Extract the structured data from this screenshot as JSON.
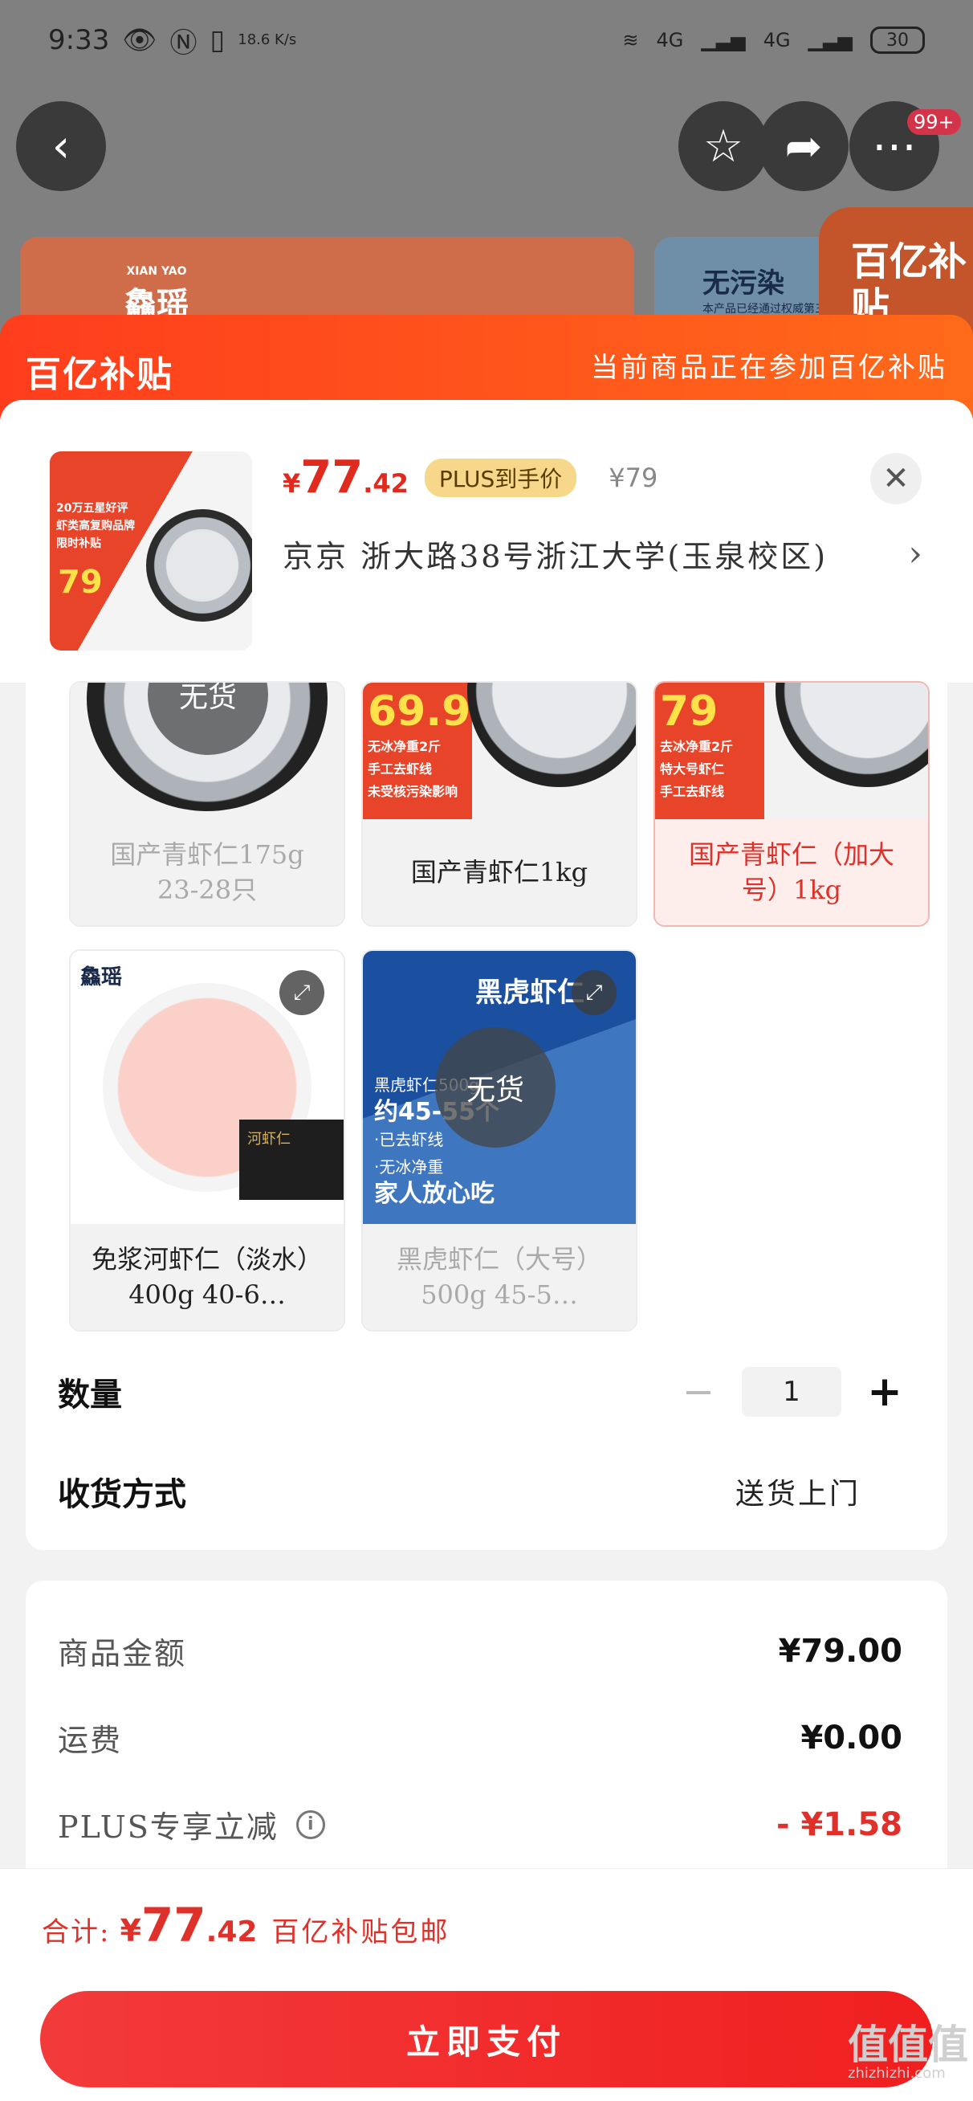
{
  "status_bar": {
    "time": "9:33",
    "speed": "18.6\nK/s",
    "network_1": "4G",
    "network_2": "4G",
    "battery": "30"
  },
  "nav": {
    "badge": "99+"
  },
  "background_page": {
    "brand_en": "XIAN YAO",
    "brand_cn": "鱻瑶",
    "right_card_text": "无污染",
    "right_card_sub": "本产品已经通过权威第三",
    "subsidy_badge": "百亿补贴"
  },
  "banner": {
    "logo": "百亿补贴",
    "note": "当前商品正在参加百亿补贴"
  },
  "product": {
    "thumb_lines": [
      "20万五星好评",
      "虾类高复购品牌",
      "限时补贴"
    ],
    "thumb_price": "79",
    "yen": "¥",
    "price_int": "77",
    "price_dec": ".42",
    "plus_tag": "PLUS到手价",
    "original_price": "¥79",
    "address": "京京   浙大路38号浙江大学(玉泉校区)",
    "chevron": "›"
  },
  "variants": [
    {
      "label": "国产青虾仁175g 23-28只",
      "soldout": "无货"
    },
    {
      "label": "国产青虾仁1kg",
      "promo_price": "69.9",
      "promo_tags": [
        "无冰净重2斤",
        "手工去虾线",
        "未受核污染影响"
      ]
    },
    {
      "label": "国产青虾仁（加大号）1kg",
      "promo_price": "79",
      "promo_tags": [
        "去冰净重2斤",
        "特大号虾仁",
        "手工去虾线"
      ]
    },
    {
      "label": "免浆河虾仁（淡水）400g 40-6…",
      "brand": "鱻瑶",
      "box_text": "河虾仁"
    },
    {
      "label": "黑虎虾仁（大号）500g 45-5…",
      "soldout": "无货",
      "box_title": "黑虎虾仁",
      "box_lines": [
        "黑虎虾仁500g",
        "约45-55个",
        "·已去虾线",
        "·无冰净重",
        "家人放心吃"
      ]
    }
  ],
  "quantity": {
    "label": "数量",
    "minus": "−",
    "value": "1",
    "plus": "+"
  },
  "delivery": {
    "label": "收货方式",
    "value": "送货上门"
  },
  "fees": [
    {
      "label": "商品金额",
      "value": "¥79.00"
    },
    {
      "label": "运费",
      "value": "¥0.00"
    },
    {
      "label": "PLUS专享立减",
      "value": "- ¥1.58"
    }
  ],
  "footer": {
    "total_label": "合计:",
    "yen": "¥",
    "total_int": "77",
    "total_dec": ".42",
    "note": "百亿补贴包邮",
    "pay_button": "立即支付"
  },
  "watermark": {
    "text": "值值值",
    "sub": "zhizhizhi.com"
  },
  "colors": {
    "accent_red": "#e0302a",
    "banner_orange": "#ff4a1c",
    "plus_gold": "#f7d88a"
  }
}
